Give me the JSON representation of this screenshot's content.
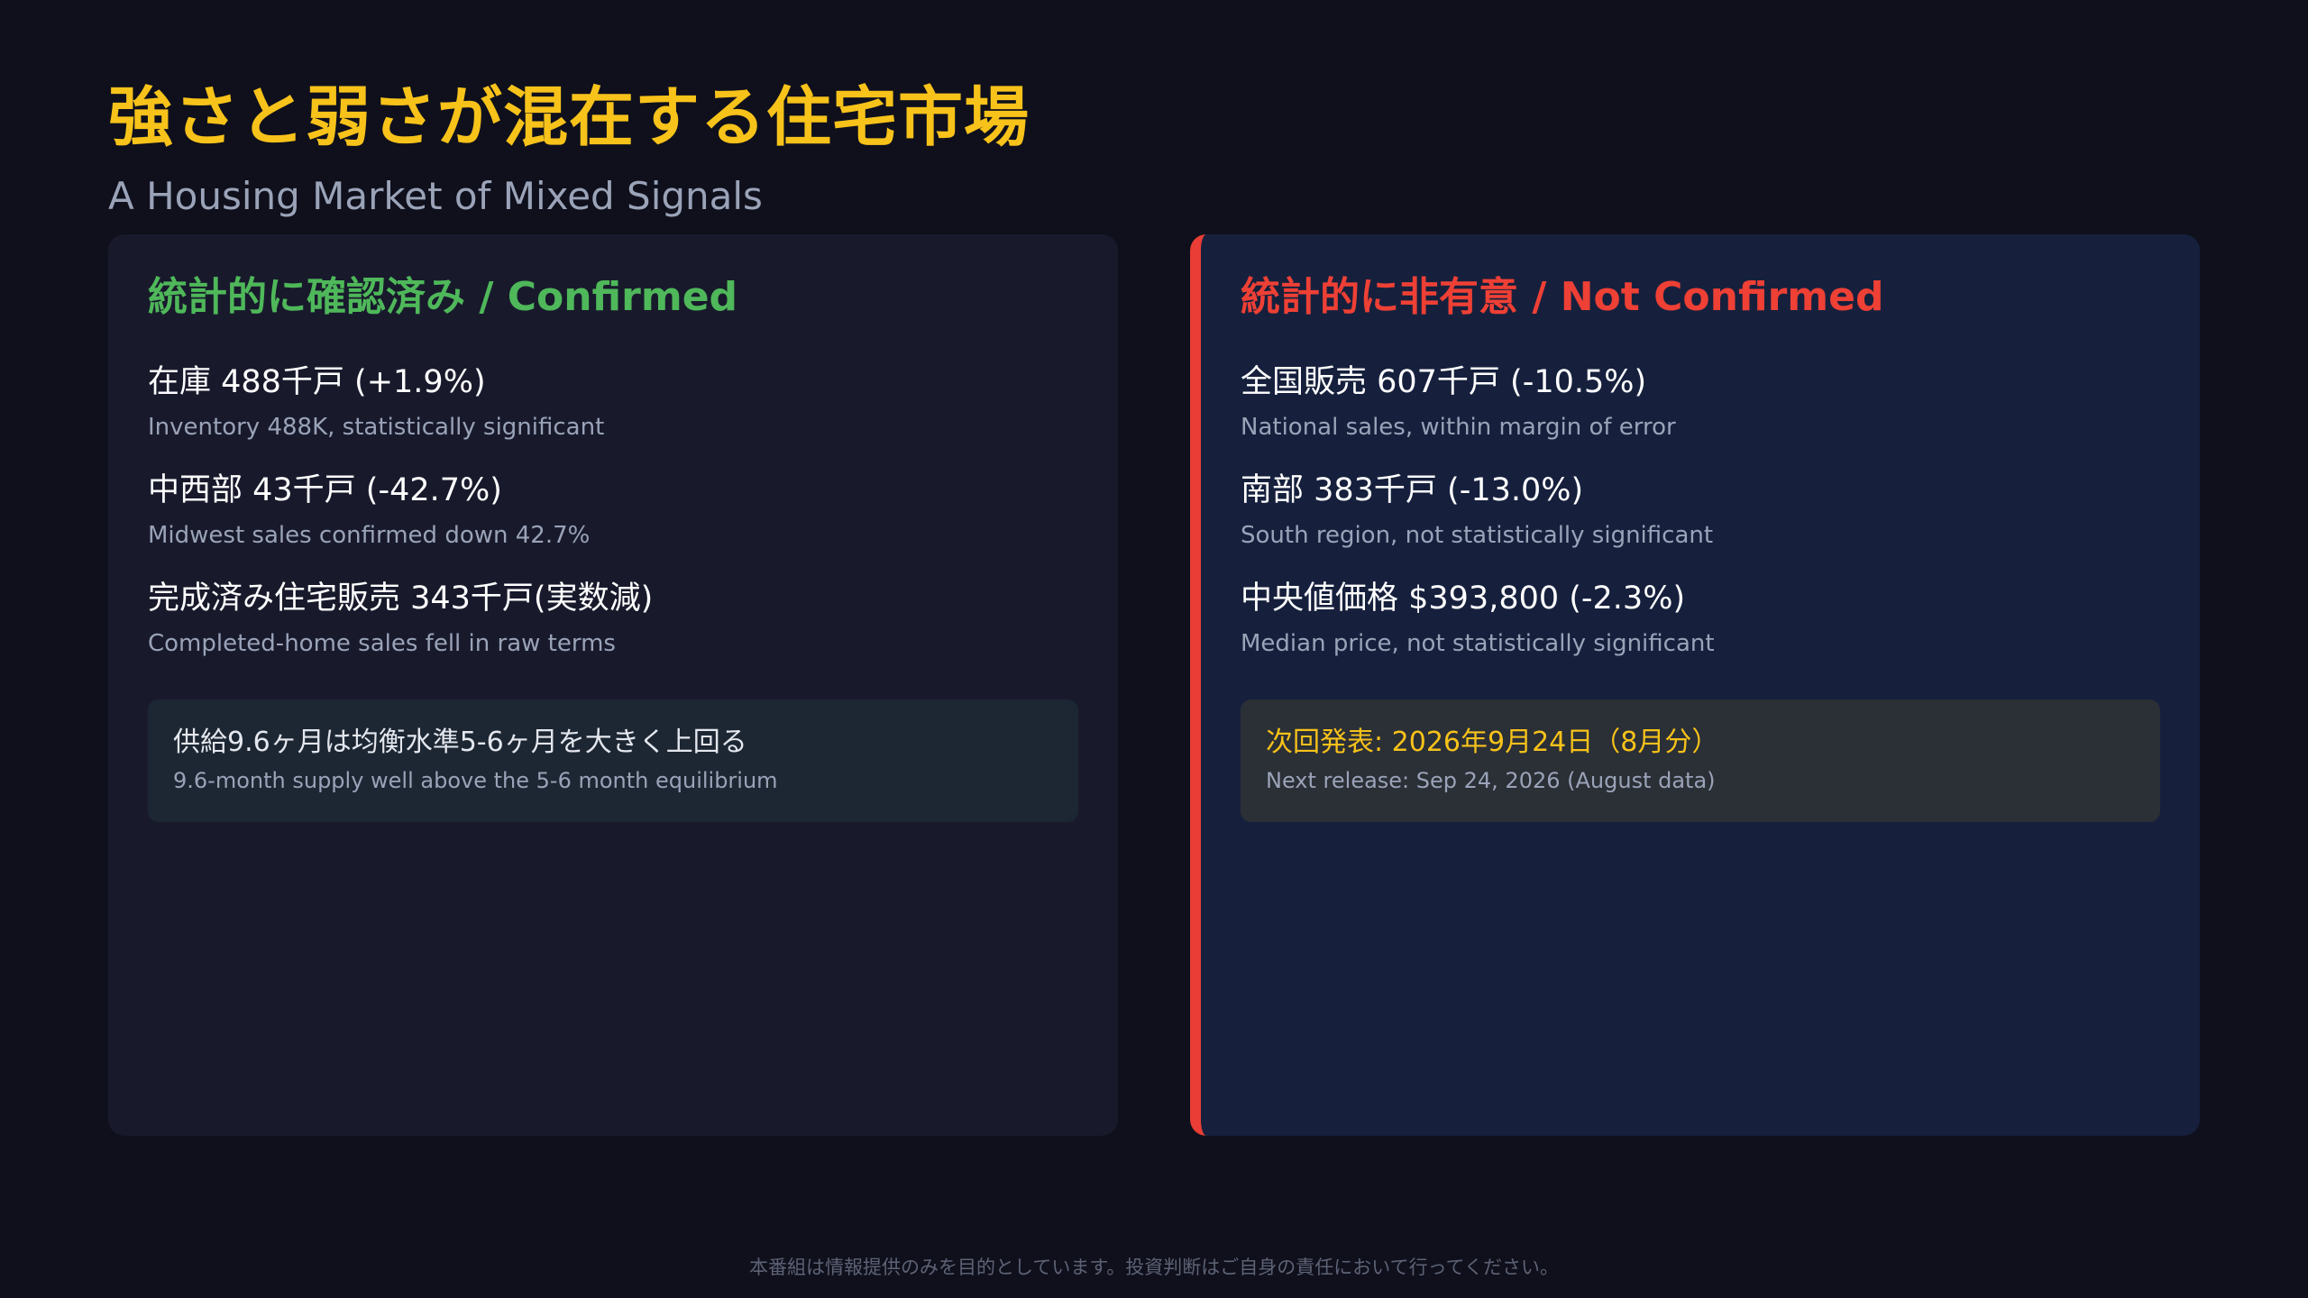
{
  "header": {
    "title": "強さと弱さが混在する住宅市場",
    "subtitle": "A Housing Market of Mixed Signals"
  },
  "confirmed": {
    "heading": "統計的に確認済み / Confirmed",
    "accent_color": "#4fb85a",
    "items": [
      {
        "main": "在庫 488千戸 (+1.9%)",
        "sub": "Inventory 488K, statistically significant"
      },
      {
        "main": "中西部 43千戸 (-42.7%)",
        "sub": "Midwest sales confirmed down 42.7%"
      },
      {
        "main": "完成済み住宅販売 343千戸(実数減)",
        "sub": "Completed-home sales fell in raw terms"
      }
    ],
    "note": {
      "main": "供給9.6ヶ月は均衡水準5-6ヶ月を大きく上回る",
      "sub": "9.6-month supply well above the 5-6 month equilibrium"
    }
  },
  "not_confirmed": {
    "heading": "統計的に非有意 / Not Confirmed",
    "accent_color": "#ee4035",
    "items": [
      {
        "main": "全国販売 607千戸 (-10.5%)",
        "sub": "National sales, within margin of error"
      },
      {
        "main": "南部 383千戸 (-13.0%)",
        "sub": "South region, not statistically significant"
      },
      {
        "main": "中央値価格 $393,800 (-2.3%)",
        "sub": "Median price, not statistically significant"
      }
    ],
    "note": {
      "main": "次回発表: 2026年9月24日（8月分）",
      "sub": "Next release: Sep 24, 2026 (August data)"
    }
  },
  "footer": {
    "disclaimer": "本番組は情報提供のみを目的としています。投資判断はご自身の責任において行ってください。"
  }
}
